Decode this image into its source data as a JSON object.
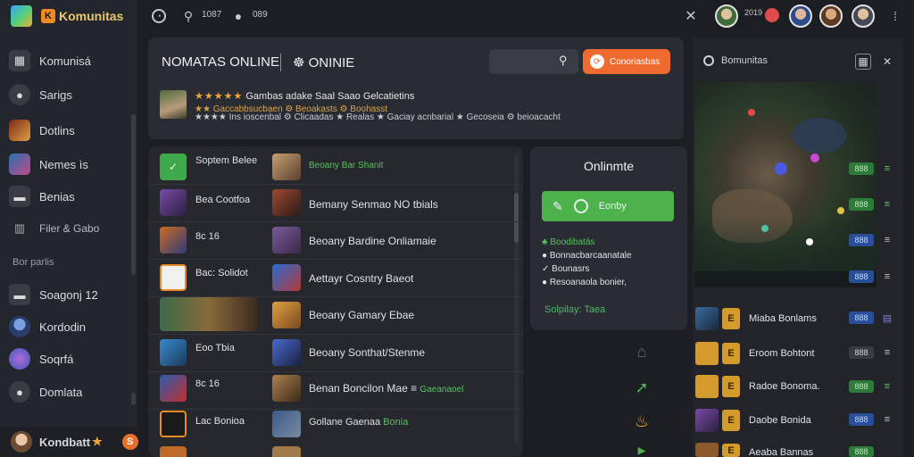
{
  "brand": {
    "name": "Komunitas",
    "badge": "K"
  },
  "sidebar": {
    "items": [
      {
        "label": "Komunisá",
        "icon": "grid-icon"
      },
      {
        "label": "Sarigs",
        "icon": "chat-icon"
      },
      {
        "label": "Dotlins",
        "icon": "game-icon"
      },
      {
        "label": "Nemes ìs",
        "icon": "game-icon"
      },
      {
        "label": "Benias",
        "icon": "folder-icon"
      },
      {
        "label": "Filer & Gabo",
        "icon": "bars-icon"
      }
    ],
    "section_label": "Bor parlis",
    "section_items": [
      {
        "label": "Soagonj 12",
        "icon": "folder-icon"
      },
      {
        "label": "Kordodin",
        "icon": "person-icon"
      },
      {
        "label": "Soqrfá",
        "icon": "globe-icon"
      },
      {
        "label": "Domlata",
        "icon": "chat-icon"
      }
    ],
    "user": {
      "name": "Kondbatt",
      "star": "★",
      "coin": "S"
    }
  },
  "topbar": {
    "count1": "1087",
    "count2": "089",
    "count3": "2019"
  },
  "header": {
    "title": "NOMATAS ONLINE",
    "subtitle_icon": "☸",
    "subtitle": "ONINIE",
    "search_placeholder": "",
    "cta_label": "Conoriasbas",
    "cta_icon": "⟳"
  },
  "hero": {
    "stars": "★★★★★",
    "line1": "Gambas adake Saal Saao Gelcatietins",
    "line2": "★★ Gaccabbsucbaen ⚙ Beoakasts ⚙ Boohasst",
    "line3": "★★★★ Ins ioscenbal ⚙ Clicaadas ★ Realas ★ Gaciay acnbarial ★ Gecoseia ⚙ beioacacht"
  },
  "list": {
    "rows": [
      {
        "a": "Soptem Belee",
        "b": "Beoany  Bar Shanit",
        "b_hl": true
      },
      {
        "a": "Bea Cootfoa",
        "b": "Bemany Senmao NO tbials",
        "b_hl": false
      },
      {
        "a": "8c 16",
        "b": "Beoany Bardine Onliamaie",
        "b_hl": false
      },
      {
        "a": "Bac: Solidot",
        "b": "Aettayr Cosntry Baeot",
        "b_hl": false
      },
      {
        "a": "",
        "b": "Beoany Gamary Ebae",
        "b_hl": false
      },
      {
        "a": "Eoo Tbia",
        "b": "Beoany Sonthat/Stenme",
        "b_hl": false
      },
      {
        "a": "8c 16",
        "b": "Benan Boncilon Mae ≡",
        "b_tail": "Gaeanaoel",
        "b_hl": false
      },
      {
        "a": "Lac Bonioa",
        "b": "Gollane Gaenaa",
        "b_tail": "Bonia",
        "b_hl": false
      }
    ]
  },
  "online": {
    "title": "Onlinmte",
    "button": "Eonby",
    "lines": [
      "♣ Boodibatás",
      "● Bonnacbarcaanatale",
      "✓ Bounasrs",
      "● Resoanaola bonier,"
    ],
    "link": "Solpilay: Taea"
  },
  "right": {
    "header": "Bomunitas",
    "map_scores": [
      "888",
      "888",
      "888",
      "888"
    ],
    "rows": [
      {
        "label": "Miaba Bonlams",
        "score": "888",
        "score_color": "blue",
        "badge": "E"
      },
      {
        "label": "Eroom Bohtont",
        "score": "888",
        "score_color": "green",
        "badge": "E"
      },
      {
        "label": "Radoe Bonoma.",
        "score": "888",
        "score_color": "green",
        "badge": "E"
      },
      {
        "label": "Daobe Bonida",
        "score": "888",
        "score_color": "blue",
        "badge": "E"
      },
      {
        "label": "Aeaba Bannas",
        "score": "888",
        "score_color": "green",
        "badge": "E"
      }
    ]
  },
  "colors": {
    "accent": "#ef6a2f",
    "online_green": "#4db14c",
    "brand_gold": "#e8c86a"
  }
}
